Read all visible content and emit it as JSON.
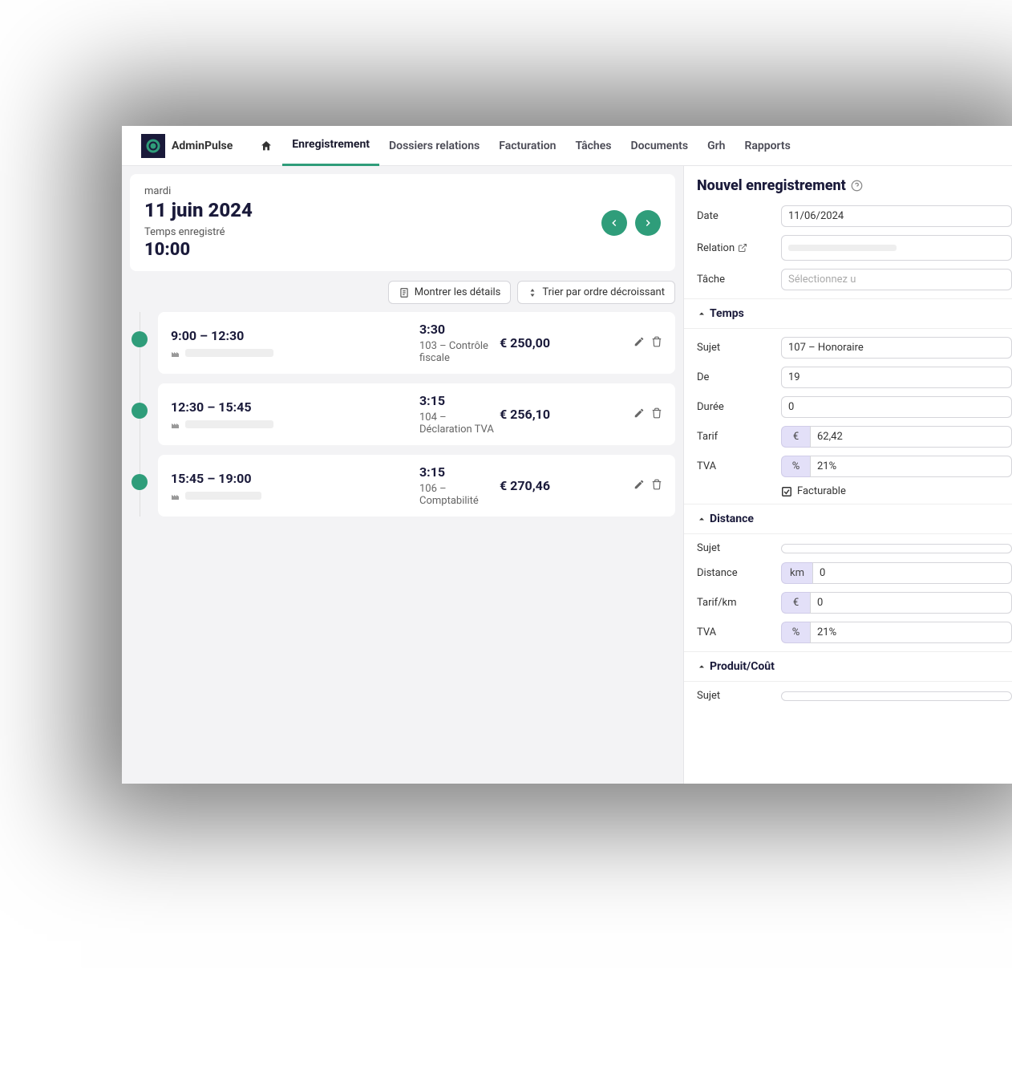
{
  "brand": "AdminPulse",
  "nav": {
    "items": [
      "Enregistrement",
      "Dossiers relations",
      "Facturation",
      "Tâches",
      "Documents",
      "Grh",
      "Rapports"
    ],
    "active": 0
  },
  "day": {
    "weekday": "mardi",
    "date": "11 juin 2024",
    "recorded_label": "Temps enregistré",
    "recorded_value": "10:00"
  },
  "toolbar": {
    "show_details": "Montrer les détails",
    "sort_desc": "Trier par ordre décroissant"
  },
  "entries": [
    {
      "time": "9:00 – 12:30",
      "duration": "3:30",
      "amount": "€ 250,00",
      "desc": "103 – Contrôle fiscale"
    },
    {
      "time": "12:30 – 15:45",
      "duration": "3:15",
      "amount": "€ 256,10",
      "desc": "104 – Déclaration TVA"
    },
    {
      "time": "15:45 – 19:00",
      "duration": "3:15",
      "amount": "€ 270,46",
      "desc": "106 – Comptabilité"
    }
  ],
  "form": {
    "title": "Nouvel enregistrement",
    "date_label": "Date",
    "date_value": "11/06/2024",
    "relation_label": "Relation",
    "task_label": "Tâche",
    "task_placeholder": "Sélectionnez u",
    "temps": {
      "header": "Temps",
      "subject_label": "Sujet",
      "subject_value": "107 – Honoraire",
      "from_label": "De",
      "from_value": "19",
      "duration_label": "Durée",
      "duration_value": "0",
      "rate_label": "Tarif",
      "rate_prefix": "€",
      "rate_value": "62,42",
      "vat_label": "TVA",
      "vat_prefix": "%",
      "vat_value": "21%",
      "billable": "Facturable"
    },
    "distance": {
      "header": "Distance",
      "subject_label": "Sujet",
      "distance_label": "Distance",
      "distance_prefix": "km",
      "distance_value": "0",
      "rate_label": "Tarif/km",
      "rate_prefix": "€",
      "rate_value": "0",
      "vat_label": "TVA",
      "vat_prefix": "%",
      "vat_value": "21%"
    },
    "product": {
      "header": "Produit/Coût",
      "subject_label": "Sujet"
    }
  }
}
